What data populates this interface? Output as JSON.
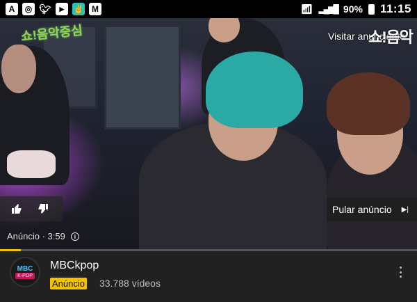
{
  "status_bar": {
    "left_icons": [
      "a-icon",
      "instagram-icon",
      "twitter-icon",
      "youtube-icon",
      "peace-icon",
      "gmail-icon"
    ],
    "battery": "90%",
    "time": "11:15"
  },
  "video": {
    "program_logo": "쇼!음악중심",
    "visit_advertiser": "Visitar anunciante",
    "watermark": "쇼!음악",
    "skip_ad": "Pular anúncio",
    "ad_time": "Anúncio · 3:59",
    "progress_fraction": 0.05,
    "accent_color": "#f2c200"
  },
  "channel": {
    "avatar_top": "MBC",
    "avatar_bottom": "K-POP",
    "name": "MBCkpop",
    "ad_badge": "Anúncio",
    "video_count": "33.788 vídeos"
  }
}
